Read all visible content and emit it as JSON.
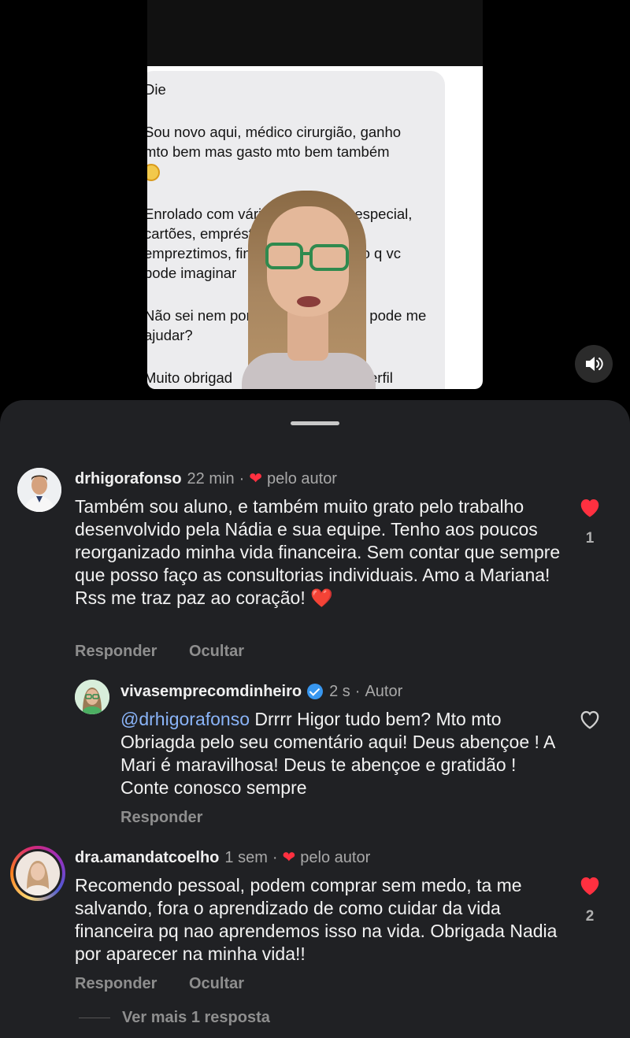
{
  "video": {
    "chat_lines": [
      "Die",
      "Sou novo aqui, médico cirurgião, ganho",
      "mto bem mas gasto mto bem também",
      "Enrolado com várias dívidas, ch especial,",
      "cartões, empréstimoss e mais",
      "empreztimos, financiamentos, tudo q vc",
      "pode imaginar",
      "Não sei nem por o",
      ", pode me",
      "ajudar?",
      "Muito obrigad",
      "erfil"
    ],
    "volume_icon": "speaker-icon"
  },
  "comments": [
    {
      "username": "drhigorafonso",
      "time": "22 min",
      "liked_by_author_label": "pelo autor",
      "text": "Também sou aluno, e também muito grato pelo trabalho desenvolvido pela Nádia e sua equipe. Tenho aos poucos reorganizado minha vida financeira. Sem contar que sempre que posso faço as consultorias individuais. Amo a Mariana! Rss me traz paz ao coração! ❤️",
      "reply_label": "Responder",
      "hide_label": "Ocultar",
      "like_count": "1",
      "liked": true
    },
    {
      "username": "vivasemprecomdinheiro",
      "time": "2 s",
      "author_label": "Autor",
      "mention": "@drhigorafonso",
      "text": " Drrrr Higor tudo bem? Mto mto Obriagda pelo seu comentário aqui! Deus abençoe ! A Mari é maravilhosa! Deus te abençoe e gratidão ! Conte conosco sempre",
      "reply_label": "Responder",
      "liked": false
    },
    {
      "username": "dra.amandatcoelho",
      "time": "1 sem",
      "liked_by_author_label": "pelo autor",
      "text": "Recomendo pessoal, podem comprar sem medo, ta me salvando, fora o aprendizado de como cuidar da vida financeira pq nao aprendemos isso na vida. Obrigada Nadia por aparecer na minha vida!!",
      "reply_label": "Responder",
      "hide_label": "Ocultar",
      "like_count": "2",
      "liked": true
    }
  ],
  "view_more_replies": "Ver mais 1 resposta",
  "colors": {
    "sheet_bg": "#202124",
    "like_red": "#ff3040",
    "mention_blue": "#8ab4f8",
    "verified_blue": "#3897f0"
  }
}
